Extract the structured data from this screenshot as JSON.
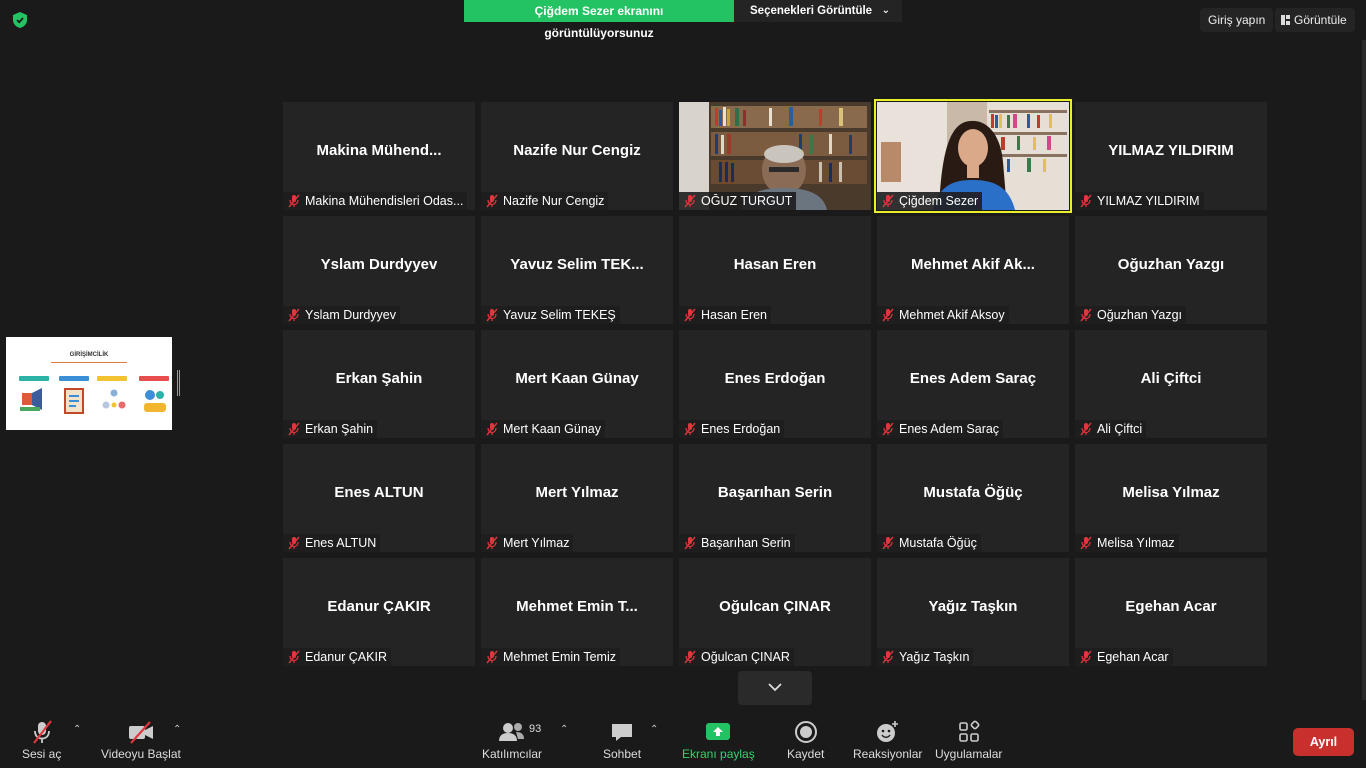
{
  "top": {
    "share_status": "Çiğdem Sezer ekranını görüntülüyorsunuz",
    "view_options": "Seçenekleri Görüntüle",
    "sign_in": "Giriş yapın",
    "view": "Görüntüle"
  },
  "thumbnail": {
    "title": "GİRİŞİMCİLİK"
  },
  "participants": [
    {
      "big": "Makina  Mühend...",
      "label": "Makina Mühendisleri Odas...",
      "video": false
    },
    {
      "big": "Nazife Nur Cengiz",
      "label": "Nazife Nur Cengiz",
      "video": false
    },
    {
      "big": "",
      "label": "OĞUZ TURGUT",
      "video": true
    },
    {
      "big": "",
      "label": "Çiğdem Sezer",
      "video": true,
      "active": true
    },
    {
      "big": "YILMAZ YILDIRIM",
      "label": "YILMAZ YILDIRIM",
      "video": false
    },
    {
      "big": "Yslam Durdyyev",
      "label": "Yslam Durdyyev",
      "video": false
    },
    {
      "big": "Yavuz Selim  TEK...",
      "label": "Yavuz Selim TEKEŞ",
      "video": false
    },
    {
      "big": "Hasan Eren",
      "label": "Hasan Eren",
      "video": false
    },
    {
      "big": "Mehmet  Akif Ak...",
      "label": "Mehmet Akif Aksoy",
      "video": false
    },
    {
      "big": "Oğuzhan Yazgı",
      "label": "Oğuzhan Yazgı",
      "video": false
    },
    {
      "big": "Erkan Şahin",
      "label": "Erkan Şahin",
      "video": false
    },
    {
      "big": "Mert Kaan Günay",
      "label": "Mert Kaan Günay",
      "video": false
    },
    {
      "big": "Enes Erdoğan",
      "label": "Enes Erdoğan",
      "video": false
    },
    {
      "big": "Enes Adem Saraç",
      "label": "Enes Adem Saraç",
      "video": false
    },
    {
      "big": "Ali Çiftci",
      "label": "Ali Çiftci",
      "video": false
    },
    {
      "big": "Enes ALTUN",
      "label": "Enes ALTUN",
      "video": false
    },
    {
      "big": "Mert Yılmaz",
      "label": "Mert Yılmaz",
      "video": false
    },
    {
      "big": "Başarıhan Serin",
      "label": "Başarıhan Serin",
      "video": false
    },
    {
      "big": "Mustafa Öğüç",
      "label": "Mustafa Öğüç",
      "video": false
    },
    {
      "big": "Melisa Yılmaz",
      "label": "Melisa Yılmaz",
      "video": false
    },
    {
      "big": "Edanur ÇAKIR",
      "label": "Edanur ÇAKIR",
      "video": false
    },
    {
      "big": "Mehmet Emin  T...",
      "label": "Mehmet Emin Temiz",
      "video": false
    },
    {
      "big": "Oğulcan ÇINAR",
      "label": "Oğulcan ÇINAR",
      "video": false
    },
    {
      "big": "Yağız Taşkın",
      "label": "Yağız Taşkın",
      "video": false
    },
    {
      "big": "Egehan Acar",
      "label": "Egehan Acar",
      "video": false
    }
  ],
  "toolbar": {
    "unmute": "Sesi aç",
    "start_video": "Videoyu Başlat",
    "participants": "Katılımcılar",
    "participant_count": "93",
    "chat": "Sohbet",
    "share_screen": "Ekranı paylaş",
    "record": "Kaydet",
    "reactions": "Reaksiyonlar",
    "apps": "Uygulamalar",
    "leave": "Ayrıl"
  },
  "colors": {
    "share_green": "#23c363",
    "active_speaker": "#e9f02a",
    "leave_red": "#c8302d",
    "muted_red": "#e0363d"
  }
}
